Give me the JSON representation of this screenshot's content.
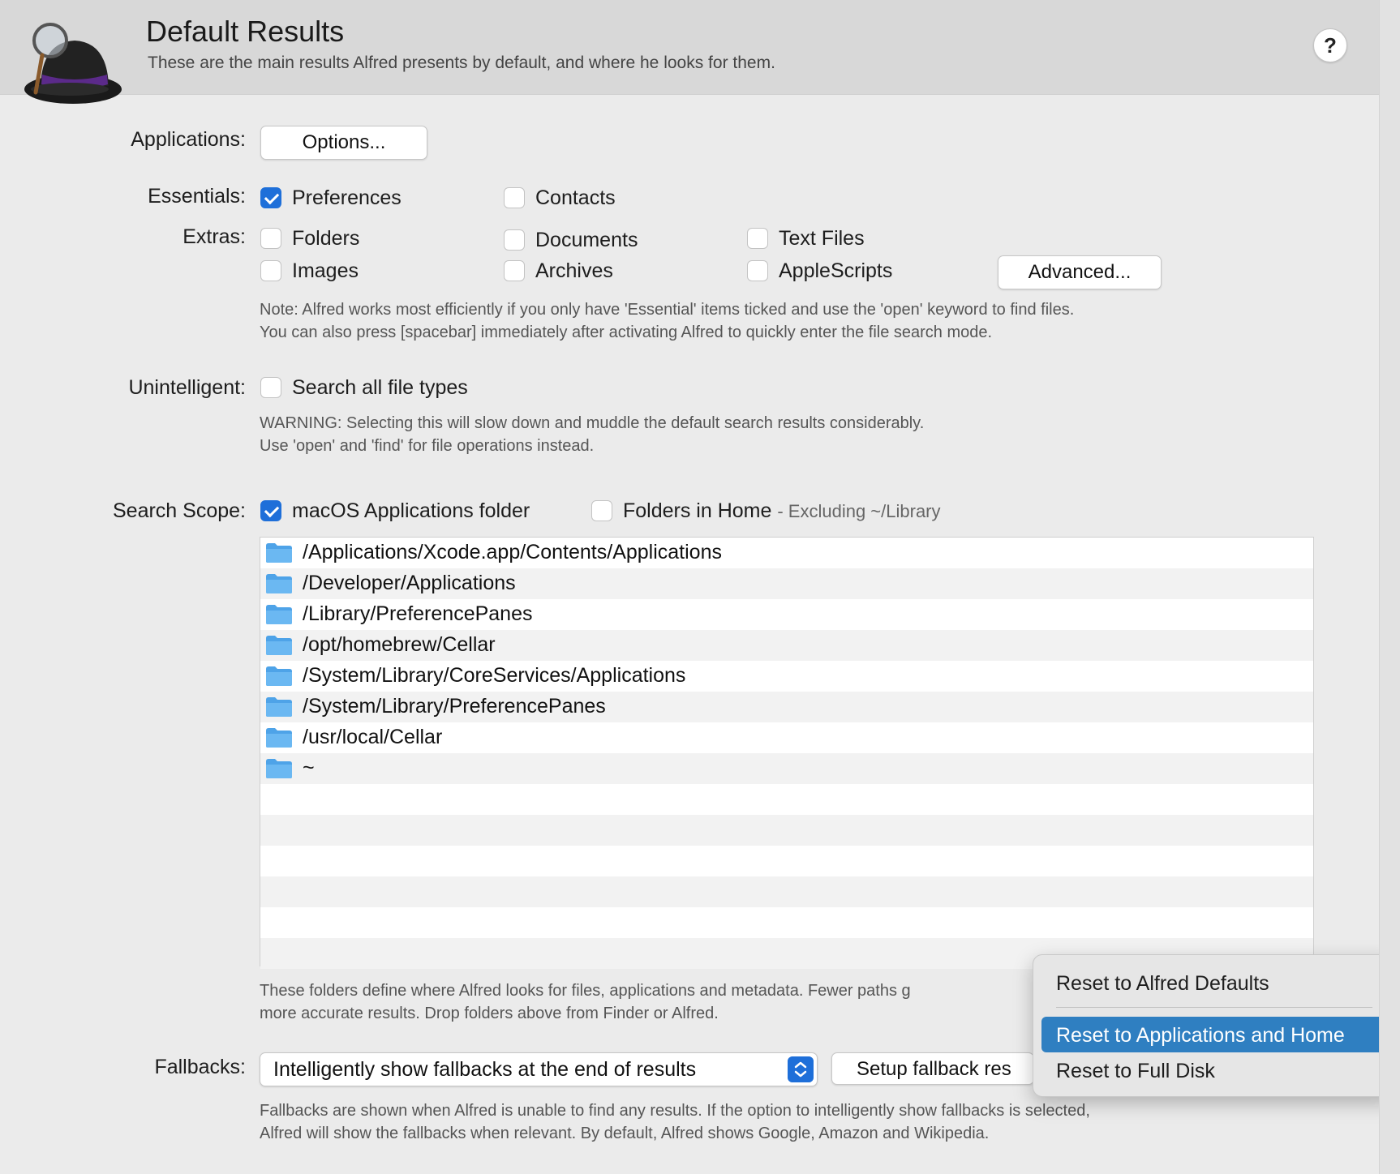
{
  "header": {
    "title": "Default Results",
    "subtitle": "These are the main results Alfred presents by default, and where he looks for them.",
    "help_label": "?"
  },
  "applications": {
    "label": "Applications:",
    "options_button": "Options..."
  },
  "essentials": {
    "label": "Essentials:",
    "items": [
      {
        "label": "Preferences",
        "checked": true
      },
      {
        "label": "Contacts",
        "checked": false
      }
    ]
  },
  "extras": {
    "label": "Extras:",
    "items": [
      {
        "label": "Folders",
        "checked": false
      },
      {
        "label": "Documents",
        "checked": false
      },
      {
        "label": "Text Files",
        "checked": false
      },
      {
        "label": "Images",
        "checked": false
      },
      {
        "label": "Archives",
        "checked": false
      },
      {
        "label": "AppleScripts",
        "checked": false
      }
    ],
    "advanced_button": "Advanced...",
    "note_line1": "Note: Alfred works most efficiently if you only have 'Essential' items ticked and use the 'open' keyword to find files.",
    "note_line2": "You can also press [spacebar] immediately after activating Alfred to quickly enter the file search mode."
  },
  "unintelligent": {
    "label": "Unintelligent:",
    "checkbox_label": "Search all file types",
    "checked": false,
    "warning_line1": "WARNING: Selecting this will slow down and muddle the default search results considerably.",
    "warning_line2": "Use 'open' and 'find' for file operations instead."
  },
  "search_scope": {
    "label": "Search Scope:",
    "apps_folder_label": "macOS Applications folder",
    "apps_folder_checked": true,
    "home_label": "Folders in Home",
    "home_checked": false,
    "home_note": "- Excluding ~/Library",
    "paths": [
      "/Applications/Xcode.app/Contents/Applications",
      "/Developer/Applications",
      "/Library/PreferencePanes",
      "/opt/homebrew/Cellar",
      "/System/Library/CoreServices/Applications",
      "/System/Library/PreferencePanes",
      "/usr/local/Cellar",
      "~"
    ],
    "note_line1": "These folders define where Alfred looks for files, applications and metadata. Fewer paths g",
    "note_line2": "more accurate results. Drop folders above from Finder or Alfred."
  },
  "fallbacks": {
    "label": "Fallbacks:",
    "select_value": "Intelligently show fallbacks at the end of results",
    "setup_button": "Setup fallback res",
    "note_line1": "Fallbacks are shown when Alfred is unable to find any results. If the option to intelligently show fallbacks is selected,",
    "note_line2": "Alfred will show the fallbacks when relevant. By default, Alfred shows Google, Amazon and Wikipedia."
  },
  "reset_menu": {
    "items": [
      {
        "label": "Reset to Alfred Defaults",
        "selected": false
      },
      {
        "label": "Reset to Applications and Home",
        "selected": true
      },
      {
        "label": "Reset to Full Disk",
        "selected": false
      }
    ]
  },
  "colors": {
    "accent": "#1e6fd9",
    "menu_selection": "#2f7fc1",
    "folder_blue": "#5aaef0"
  }
}
